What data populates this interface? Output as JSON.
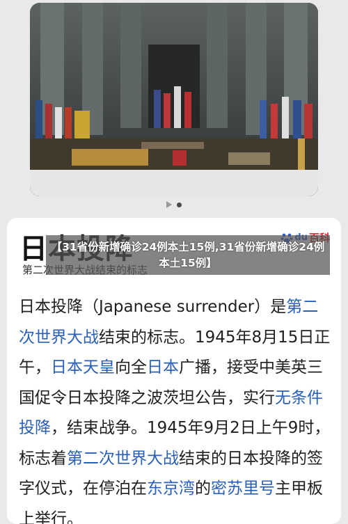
{
  "overlay_headline": "【31省份新增确诊24例本土15例,31省份新增确诊24例 本土15例】",
  "article": {
    "title": "日本投降",
    "subtitle": "第二次世界大战结束的标志",
    "source_logo": {
      "text": "百科",
      "paw_text": "du"
    },
    "body": {
      "s01": "日本投降（Japanese surrender）是",
      "l01": "第二次世界大战",
      "s02": "结束的标志。1945年8月15日正午，",
      "l02": "日本天皇",
      "s03": "向全",
      "l03": "日本",
      "s04": "广播，接受中美英三国促令日本投降之波茨坦公告，实行",
      "l04": "无条件投降",
      "s05": "，结束战争。1945年9月2日上午9时，标志着",
      "l05": "第二次世界大战",
      "s06": "结束的日本投降的签字仪式，在停泊在",
      "l06": "东京湾",
      "s07": "的",
      "l07": "密苏里号",
      "s08": "主甲板上举行。"
    }
  },
  "carousel": {
    "total": 2,
    "active": 2
  },
  "colors": {
    "link": "#2a5fb8",
    "baike_red": "#d8262a",
    "baike_blue": "#2c5fd6"
  }
}
